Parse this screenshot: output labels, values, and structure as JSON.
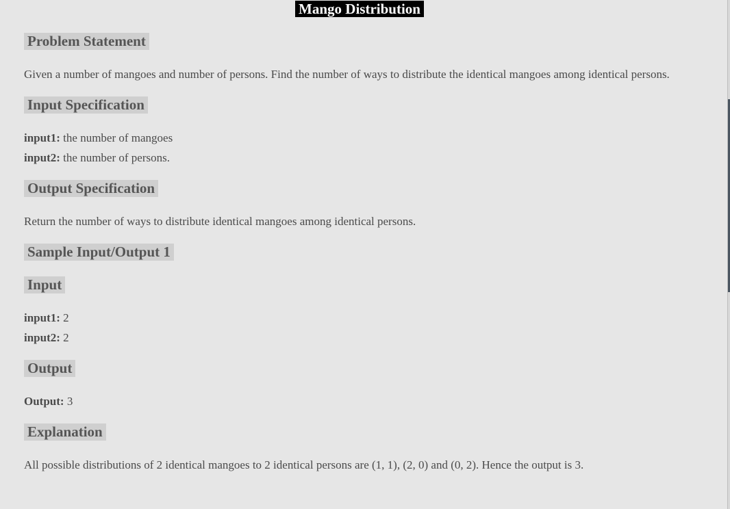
{
  "title": "Mango Distribution",
  "sections": {
    "problem": {
      "heading": "Problem Statement",
      "text": "Given a number of mangoes and number of persons. Find the number of ways to distribute the identical mangoes among identical persons."
    },
    "input_spec": {
      "heading": "Input Specification",
      "line1_key": "input1:",
      "line1_val": " the number of mangoes",
      "line2_key": "input2:",
      "line2_val": " the number of persons."
    },
    "output_spec": {
      "heading": "Output Specification",
      "text": "Return the number of ways to distribute identical mangoes among identical persons."
    },
    "sample": {
      "heading": "Sample Input/Output 1"
    },
    "input": {
      "heading": "Input",
      "line1_key": "input1:",
      "line1_val": " 2",
      "line2_key": "input2:",
      "line2_val": " 2"
    },
    "output": {
      "heading": "Output",
      "line_key": "Output:",
      "line_val": " 3"
    },
    "explanation": {
      "heading": "Explanation",
      "text": "All possible distributions of 2 identical mangoes to 2 identical persons are (1, 1), (2, 0) and (0, 2). Hence the output is 3."
    }
  }
}
